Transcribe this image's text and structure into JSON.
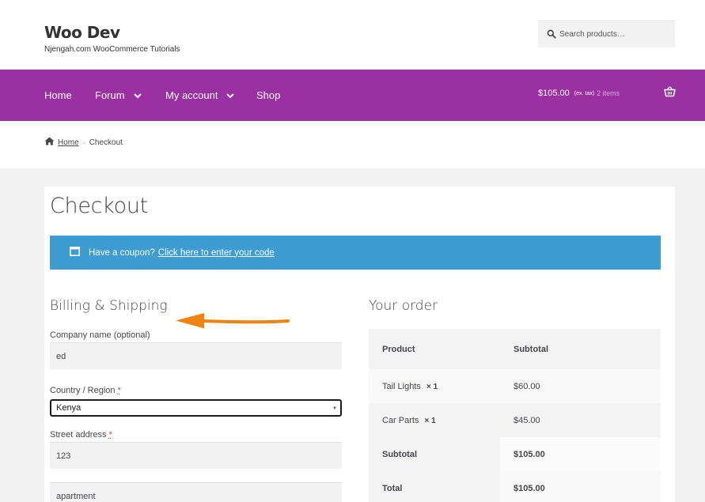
{
  "site": {
    "title": "Woo Dev",
    "tagline": "Njengah.com WooCommerce Tutorials"
  },
  "search": {
    "placeholder": "Search products…",
    "icon": "search-icon"
  },
  "nav": {
    "items": [
      {
        "label": "Home",
        "has_dropdown": false
      },
      {
        "label": "Forum",
        "has_dropdown": true
      },
      {
        "label": "My account",
        "has_dropdown": true
      },
      {
        "label": "Shop",
        "has_dropdown": false
      }
    ],
    "cart": {
      "amount": "$105.00",
      "tax_note": "(ex. tax)",
      "items": "2 items",
      "icon": "basket-icon"
    }
  },
  "breadcrumb": {
    "home": "Home",
    "separator": "›",
    "current": "Checkout"
  },
  "page": {
    "title": "Checkout"
  },
  "coupon": {
    "text": "Have a coupon?",
    "link": "Click here to enter your code"
  },
  "billing": {
    "heading": "Billing & Shipping",
    "company_label": "Company name (optional)",
    "company_value": "ed",
    "country_label": "Country / Region",
    "country_value": "Kenya",
    "street_label": "Street address",
    "street_value": "123",
    "street2_value": "apartment",
    "required_mark": "*"
  },
  "order": {
    "heading": "Your order",
    "header": {
      "product": "Product",
      "subtotal": "Subtotal"
    },
    "rows": [
      {
        "product": "Tail Lights",
        "qty": "× 1",
        "subtotal": "$60.00"
      },
      {
        "product": "Car Parts",
        "qty": "× 1",
        "subtotal": "$45.00"
      }
    ],
    "subtotal_label": "Subtotal",
    "subtotal_value": "$105.00",
    "total_label": "Total",
    "total_value": "$105.00"
  },
  "colors": {
    "nav_bg": "#9b30a3",
    "coupon_bg": "#3d9cd2",
    "annotation_arrow": "#f0820f",
    "required": "#e2401c"
  }
}
